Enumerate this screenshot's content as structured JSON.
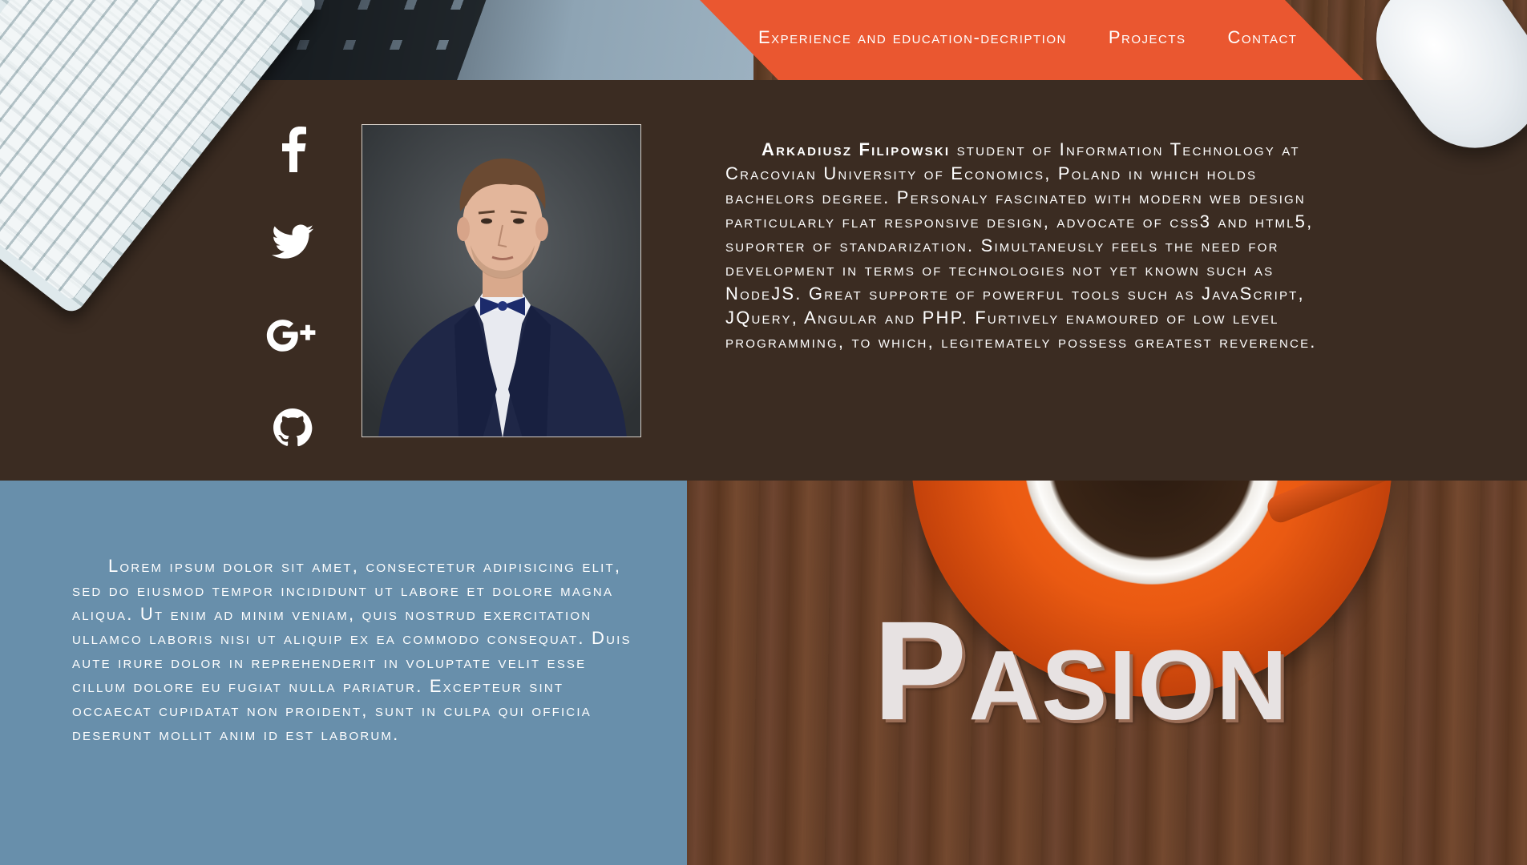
{
  "nav": {
    "items": [
      {
        "label": "Experience and education-decription"
      },
      {
        "label": "Projects"
      },
      {
        "label": "Contact"
      }
    ]
  },
  "colors": {
    "accent": "#ea5730",
    "dark_brown": "#3b2c22",
    "steel_blue": "#688fab",
    "text": "#ffffff"
  },
  "social": {
    "icons": [
      "facebook-icon",
      "twitter-icon",
      "google-plus-icon",
      "github-icon"
    ]
  },
  "about": {
    "name": "Arkadiusz Filipowski",
    "bio": " student of Information Technology at Cracovian University of Economics, Poland in which holds bachelors degree. Personaly fascinated with modern web design particularly flat responsive design, advocate of css3 and html5, suporter of standarization. Simultaneusly feels the need for development in terms of technologies not yet known such as NodeJS. Great supporte of powerful tools such as JavaScript, JQuery, Angular and PHP. Furtively enamoured of low level programming, to which, legitemately possess greatest reverence."
  },
  "lorem": {
    "text": "Lorem ipsum dolor sit amet, consectetur adipisicing elit, sed do eiusmod tempor incididunt ut labore et dolore magna aliqua. Ut enim ad minim veniam, quis nostrud exercitation ullamco laboris nisi ut aliquip ex ea commodo consequat. Duis aute irure dolor in reprehenderit in voluptate velit esse cillum dolore eu fugiat nulla pariatur. Excepteur sint occaecat cupidatat non proident, sunt in culpa qui officia deserunt mollit anim id est laborum."
  },
  "pasion": {
    "title": "Pasion"
  }
}
